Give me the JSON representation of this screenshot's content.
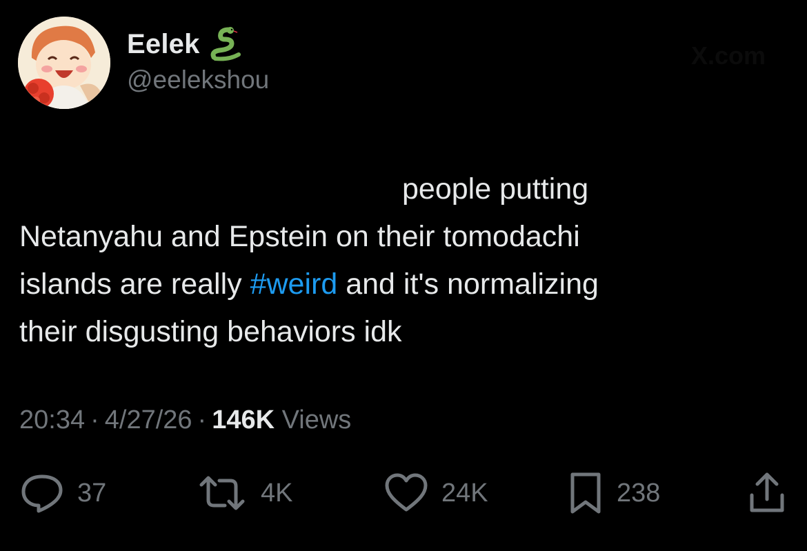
{
  "author": {
    "display_name": "Eelek",
    "handle": "@eelekshou",
    "emoji_icon": "snake-emoji-icon",
    "avatar": "cartoon-avatar"
  },
  "watermark": "X.com",
  "tweet": {
    "lines": [
      "people putting",
      "Netanyahu and Epstein on their tomodachi",
      "islands are really ",
      "#weird",
      " and it's normalizing",
      "their disgusting behaviors idk"
    ],
    "hashtag_color": "#1d9bf0"
  },
  "meta": {
    "time": "20:34",
    "date": "4/27/26",
    "separator": "·",
    "views_count": "146K",
    "views_label": "Views"
  },
  "actions": {
    "reply_count": "37",
    "retweet_count": "4K",
    "like_count": "24K",
    "bookmark_count": "238"
  },
  "colors": {
    "background": "#000000",
    "text_primary": "#e7e9ea",
    "text_secondary": "#71767b",
    "accent": "#1d9bf0"
  }
}
